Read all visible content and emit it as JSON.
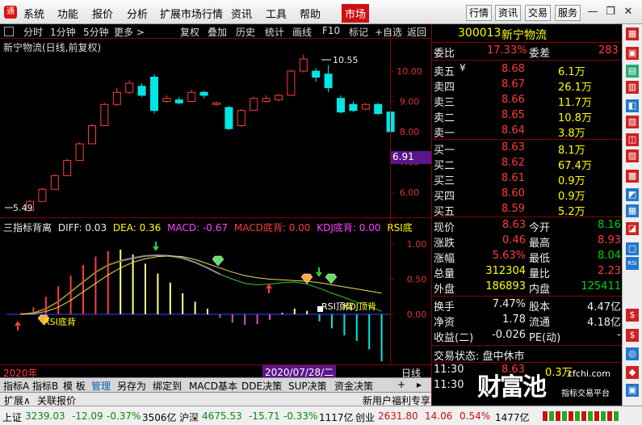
{
  "menu": {
    "items": [
      "系统",
      "功能",
      "报价",
      "分析",
      "扩展市场行情",
      "资讯",
      "工具",
      "帮助"
    ],
    "active": "市场",
    "right": [
      "行情",
      "资讯",
      "交易",
      "服务"
    ]
  },
  "toolbar": {
    "items": [
      "分时",
      "1分钟",
      "5分钟",
      "更多 >",
      "复权",
      "叠加",
      "历史",
      "统计",
      "画线",
      "F10",
      "标记",
      "+自选",
      "返回"
    ]
  },
  "kline": {
    "title": "新宁物流(日线,前复权)",
    "high_label": "10.55",
    "low_label": "5.49",
    "y_ticks": [
      "10.00",
      "9.00",
      "8.00",
      "7.00",
      "6.00"
    ],
    "price_tag": "6.91",
    "candles": [
      {
        "o": 5.4,
        "c": 5.7,
        "h": 5.75,
        "l": 5.49
      },
      {
        "o": 5.7,
        "c": 6.1,
        "h": 6.15,
        "l": 5.7
      },
      {
        "o": 6.1,
        "c": 6.55,
        "h": 6.6,
        "l": 6.1
      },
      {
        "o": 6.55,
        "c": 7.05,
        "h": 7.1,
        "l": 6.55
      },
      {
        "o": 7.05,
        "c": 7.6,
        "h": 7.65,
        "l": 7.05
      },
      {
        "o": 7.6,
        "c": 8.2,
        "h": 8.25,
        "l": 7.6
      },
      {
        "o": 8.2,
        "c": 8.9,
        "h": 8.95,
        "l": 8.2
      },
      {
        "o": 8.9,
        "c": 9.3,
        "h": 9.45,
        "l": 8.85
      },
      {
        "o": 9.3,
        "c": 9.6,
        "h": 9.7,
        "l": 9.25
      },
      {
        "o": 9.5,
        "c": 9.2,
        "h": 9.6,
        "l": 9.15
      },
      {
        "o": 9.8,
        "c": 8.7,
        "h": 9.9,
        "l": 8.6
      },
      {
        "o": 9.0,
        "c": 9.1,
        "h": 9.2,
        "l": 8.95
      },
      {
        "o": 9.05,
        "c": 8.95,
        "h": 9.15,
        "l": 8.9
      },
      {
        "o": 9.0,
        "c": 9.3,
        "h": 9.4,
        "l": 8.98
      },
      {
        "o": 9.3,
        "c": 9.2,
        "h": 9.35,
        "l": 9.1
      },
      {
        "o": 8.9,
        "c": 8.95,
        "h": 9.0,
        "l": 8.85
      },
      {
        "o": 8.8,
        "c": 8.1,
        "h": 8.85,
        "l": 8.05
      },
      {
        "o": 8.2,
        "c": 8.7,
        "h": 8.75,
        "l": 8.15
      },
      {
        "o": 8.7,
        "c": 9.1,
        "h": 9.15,
        "l": 8.7
      },
      {
        "o": 9.0,
        "c": 9.1,
        "h": 9.2,
        "l": 8.95
      },
      {
        "o": 9.05,
        "c": 9.2,
        "h": 9.25,
        "l": 9.0
      },
      {
        "o": 9.2,
        "c": 10.0,
        "h": 10.05,
        "l": 9.2
      },
      {
        "o": 10.0,
        "c": 10.4,
        "h": 10.55,
        "l": 9.95
      },
      {
        "o": 10.0,
        "c": 9.8,
        "h": 10.1,
        "l": 9.65
      },
      {
        "o": 9.9,
        "c": 9.45,
        "h": 10.2,
        "l": 9.3
      },
      {
        "o": 9.1,
        "c": 8.65,
        "h": 9.2,
        "l": 8.6
      },
      {
        "o": 8.9,
        "c": 8.7,
        "h": 9.0,
        "l": 8.65
      },
      {
        "o": 8.75,
        "c": 8.9,
        "h": 8.95,
        "l": 8.7
      },
      {
        "o": 8.9,
        "c": 8.6,
        "h": 8.95,
        "l": 8.55
      },
      {
        "o": 8.65,
        "c": 8.0,
        "h": 8.7,
        "l": 7.95
      }
    ]
  },
  "indicator": {
    "name": "三指标背离",
    "diff": "DIFF: 0.03",
    "dea": "DEA: 0.36",
    "macd": "MACD: -0.67",
    "macd_div": "MACD底背: 0.00",
    "kdj_div": "KDJ底背: 0.00",
    "rsi_div": "RSI底",
    "y_ticks": [
      "1.00",
      "0.50",
      "0.00"
    ],
    "labels": [
      "RSI底背",
      "RSI顶背",
      "KDJ顶背"
    ],
    "macd_bars": [
      0.02,
      0.1,
      0.25,
      0.4,
      0.55,
      0.7,
      0.82,
      0.9,
      0.92,
      0.85,
      0.72,
      0.58,
      0.45,
      0.3,
      0.18,
      0.08,
      -0.05,
      -0.12,
      -0.15,
      -0.14,
      -0.08,
      0.02,
      0.08,
      0.05,
      -0.1,
      -0.2,
      -0.3,
      -0.38,
      -0.5,
      -0.67
    ]
  },
  "datebar": {
    "year": "2020年",
    "date": "2020/07/28/二",
    "period": "日线"
  },
  "tabs": [
    "指标A",
    "指标B",
    "模 板",
    "管理",
    "另存为",
    "绑定到",
    "MACD基本",
    "DDE决策",
    "SUP决策",
    "资金决策",
    "+",
    "▸"
  ],
  "tabs2": {
    "left": [
      "扩展∧",
      "关联报价"
    ],
    "right": [
      "新用户福利专享",
      "笔",
      "价"
    ]
  },
  "quote": {
    "code": "300013",
    "name": "新宁物流",
    "weibi_label": "委比",
    "weibi": "17.33%",
    "weicha_label": "委差",
    "weicha": "283",
    "asks": [
      {
        "label": "卖五",
        "price": "8.68",
        "vol": "6.1万"
      },
      {
        "label": "卖四",
        "price": "8.67",
        "vol": "26.1万"
      },
      {
        "label": "卖三",
        "price": "8.66",
        "vol": "11.7万"
      },
      {
        "label": "卖二",
        "price": "8.65",
        "vol": "10.8万"
      },
      {
        "label": "卖一",
        "price": "8.64",
        "vol": "3.8万"
      }
    ],
    "bids": [
      {
        "label": "买一",
        "price": "8.63",
        "vol": "8.1万"
      },
      {
        "label": "买二",
        "price": "8.62",
        "vol": "67.4万"
      },
      {
        "label": "买三",
        "price": "8.61",
        "vol": "0.9万"
      },
      {
        "label": "买四",
        "price": "8.60",
        "vol": "0.9万"
      },
      {
        "label": "买五",
        "price": "8.59",
        "vol": "5.2万"
      }
    ],
    "stats": [
      [
        "现价",
        "8.63",
        "今开",
        "8.16"
      ],
      [
        "涨跌",
        "0.46",
        "最高",
        "8.93"
      ],
      [
        "涨幅",
        "5.63%",
        "最低",
        "8.04"
      ],
      [
        "总量",
        "312304",
        "量比",
        "2.23"
      ],
      [
        "外盘",
        "186893",
        "内盘",
        "125411"
      ]
    ],
    "stats2": [
      [
        "换手",
        "7.47%",
        "股本",
        "4.47亿"
      ],
      [
        "净资",
        "1.78",
        "流通",
        "4.18亿"
      ],
      [
        "收益(二)",
        "-0.026",
        "PE(动)",
        "-"
      ]
    ],
    "trade_state": "交易状态: 盘中休市",
    "ticks": [
      {
        "t": "11:30",
        "p": "8.63",
        "v": "0.3万"
      },
      {
        "t": "11:30",
        "p": "",
        "v": ""
      }
    ]
  },
  "watermark": {
    "main": "财富池",
    "site": "cfchi.com",
    "sub": "指标交易平台"
  },
  "statusbar": {
    "items": [
      {
        "name": "上证",
        "val": "3239.03",
        "chg": "-12.09",
        "pct": "-0.37%",
        "amt": "3506亿"
      },
      {
        "name": "沪深",
        "val": "4675.53",
        "chg": "-15.71",
        "pct": "-0.33%",
        "amt": "1117亿"
      },
      {
        "name": "创业",
        "val": "2631.80",
        "chg": "14.06",
        "pct": "0.54%",
        "amt": "1477亿"
      }
    ]
  },
  "colors": {
    "up": "#ff3b3b",
    "down": "#00e5e5",
    "accent": "#cc1111"
  }
}
